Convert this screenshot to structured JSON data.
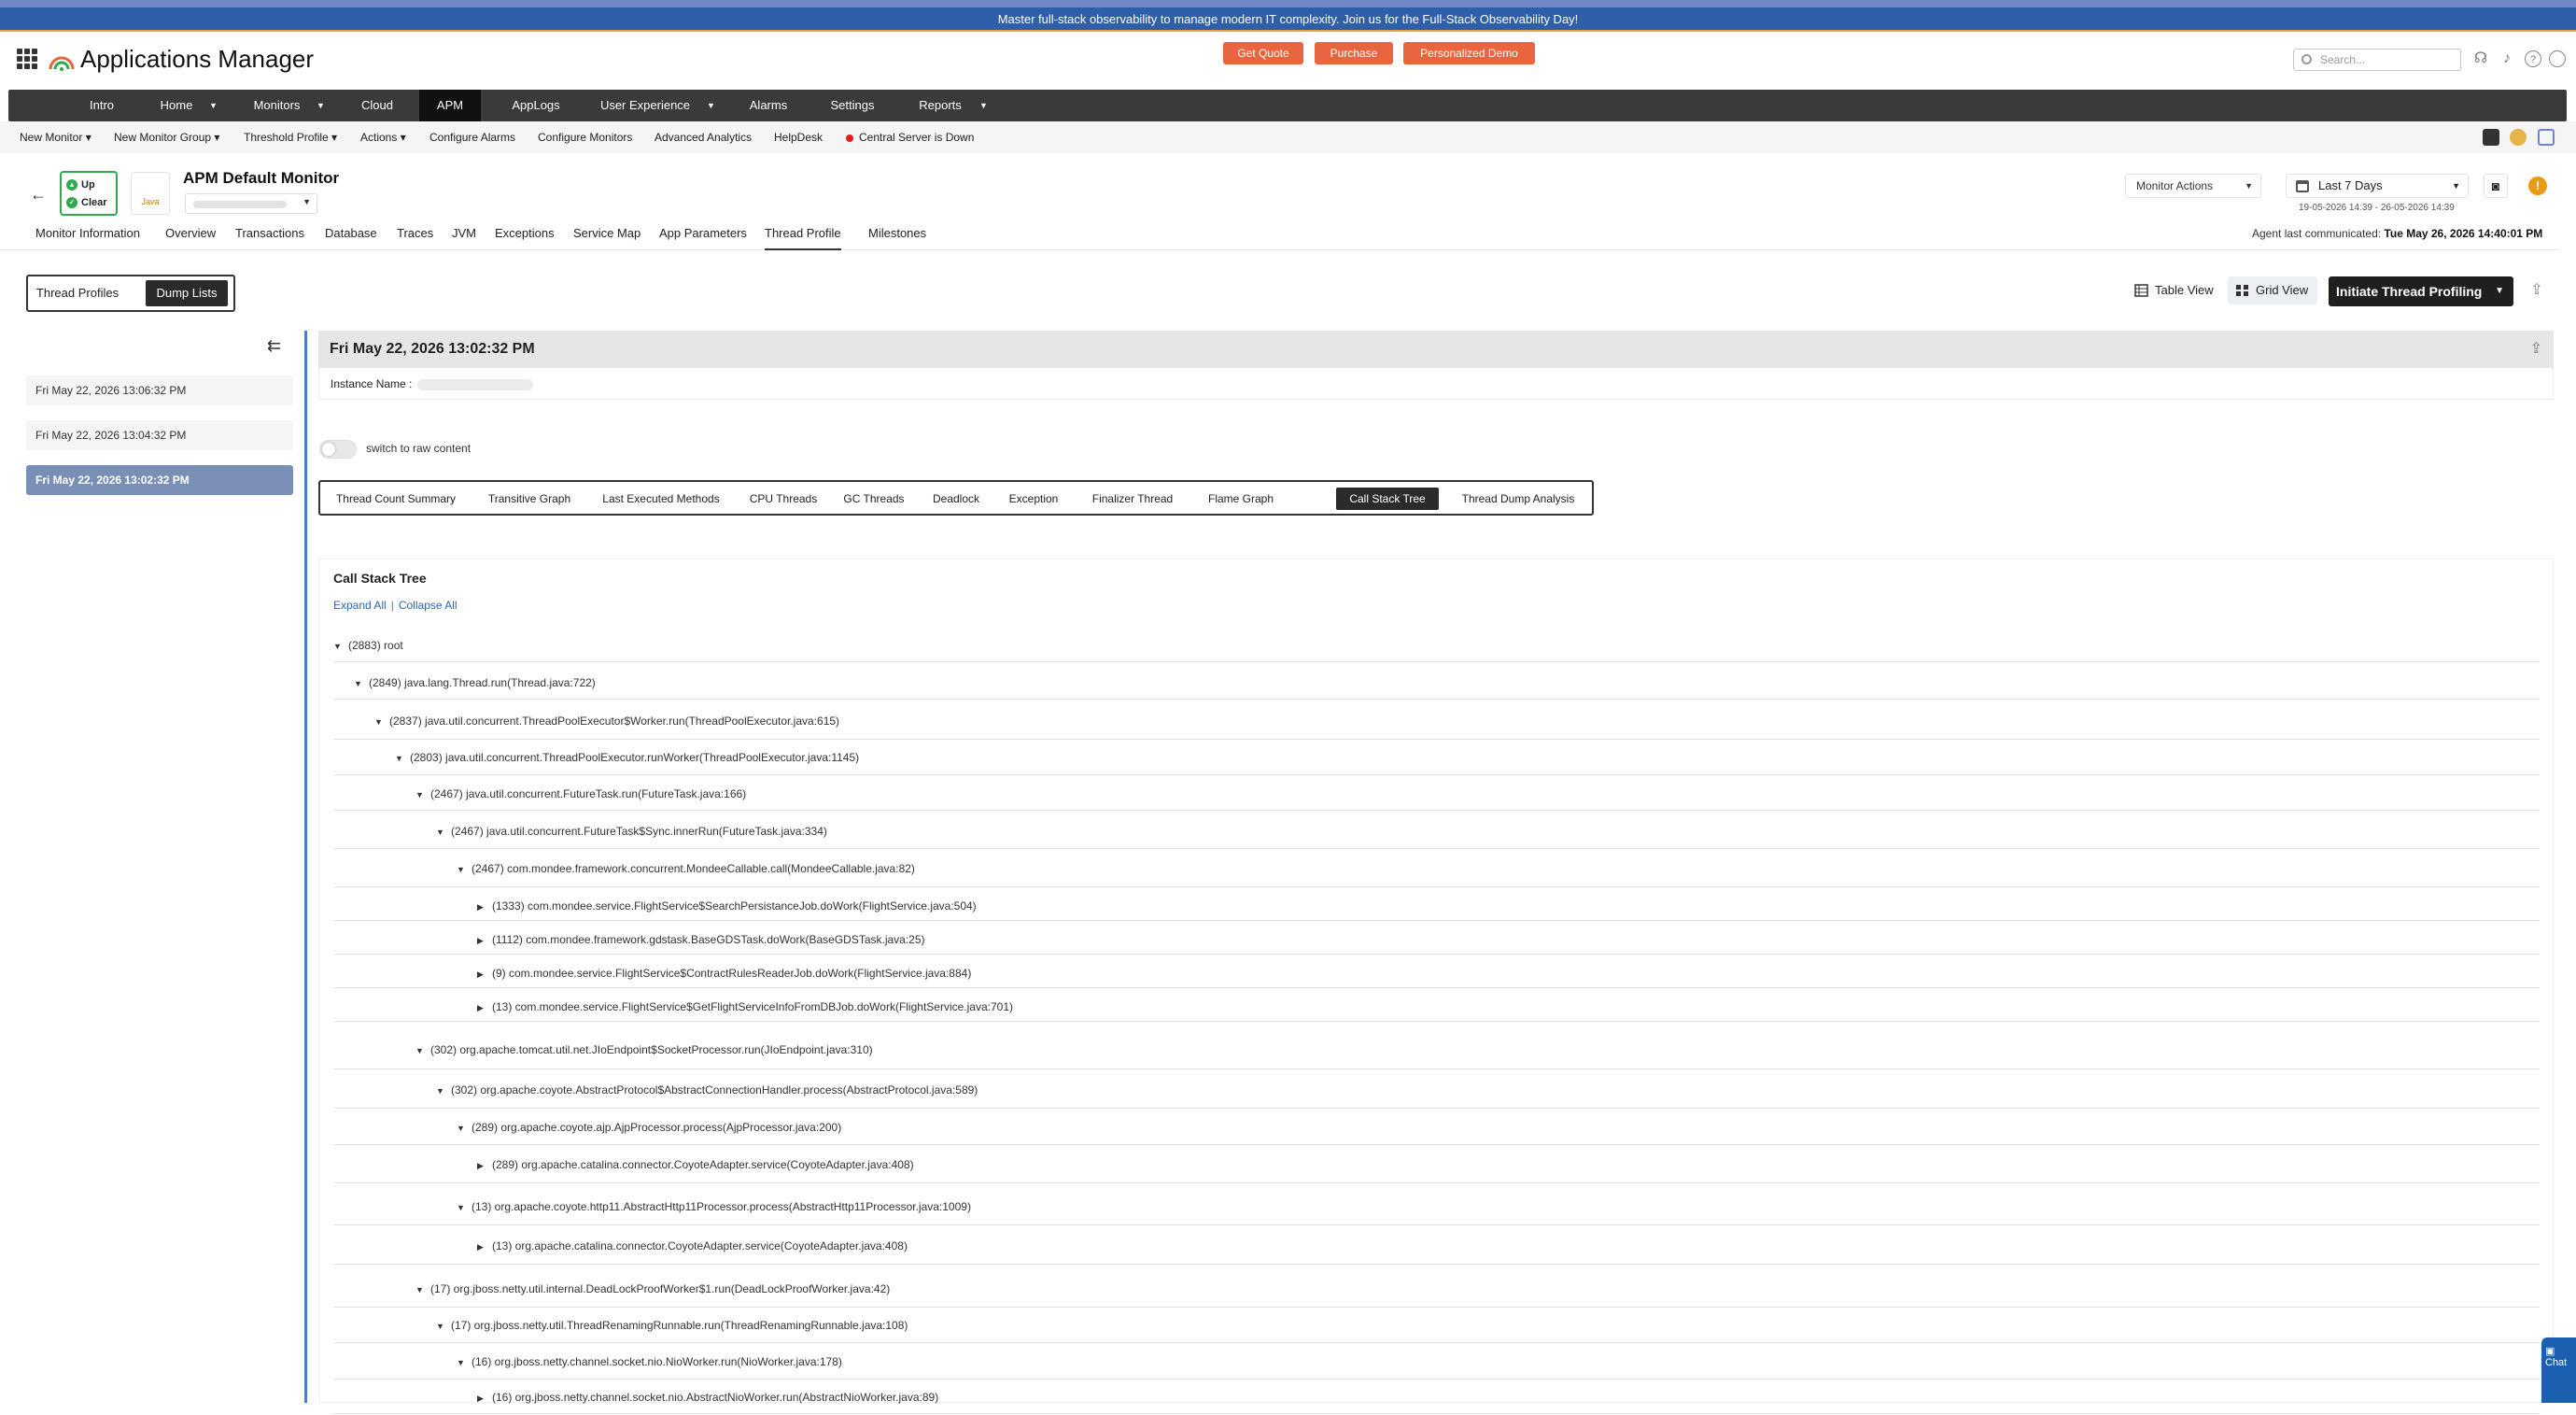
{
  "banner": "Master full-stack observability to manage modern IT complexity. Join us for the Full-Stack Observability Day!",
  "app": {
    "title": "Applications Manager",
    "accent": "#e9653f",
    "brand_green": "#2eaa4f"
  },
  "header": {
    "buttons": [
      "Get Quote",
      "Purchase",
      "Personalized Demo"
    ],
    "search_placeholder": "Search..."
  },
  "mainnav": [
    "Intro",
    "Home",
    "Monitors",
    "Cloud",
    "APM",
    "AppLogs",
    "User Experience",
    "Alarms",
    "Settings",
    "Reports"
  ],
  "mainnav_active": "APM",
  "subnav": [
    "New Monitor",
    "New Monitor Group",
    "Threshold Profile",
    "Actions",
    "Configure Alarms",
    "Configure Monitors",
    "Advanced Analytics",
    "HelpDesk",
    "Central Server is Down"
  ],
  "monitor": {
    "status_up": "Up",
    "status_clear": "Clear",
    "type_icon_label": "Java",
    "title": "APM Default Monitor",
    "actions_label": "Monitor Actions",
    "range_label": "Last 7 Days",
    "range_dates": "19-05-2026 14:39 - 26-05-2026 14:39"
  },
  "tabs": [
    "Monitor Information",
    "Overview",
    "Transactions",
    "Database",
    "Traces",
    "JVM",
    "Exceptions",
    "Service Map",
    "App Parameters",
    "Thread Profile",
    "Milestones"
  ],
  "tab_active": "Thread Profile",
  "agent": {
    "label": "Agent last communicated:",
    "value": "Tue May 26, 2026 14:40:01 PM"
  },
  "toggle": {
    "left": "Thread Profiles",
    "right": "Dump Lists"
  },
  "views": {
    "table": "Table View",
    "grid": "Grid View",
    "initiate": "Initiate Thread Profiling"
  },
  "dumps": [
    "Fri May 22, 2026 13:06:32 PM",
    "Fri May 22, 2026 13:04:32 PM",
    "Fri May 22, 2026 13:02:32 PM"
  ],
  "dump_active": "Fri May 22, 2026 13:02:32 PM",
  "panel": {
    "title": "Fri May 22, 2026 13:02:32 PM",
    "instance_label": "Instance Name :",
    "switch_label": "switch to raw content"
  },
  "subtabs": [
    "Thread Count Summary",
    "Transitive Graph",
    "Last Executed Methods",
    "CPU Threads",
    "GC Threads",
    "Deadlock",
    "Exception",
    "Finalizer Thread",
    "Flame Graph",
    "Call Stack Tree",
    "Thread Dump Analysis"
  ],
  "subtab_active": "Call Stack Tree",
  "tree": {
    "title": "Call Stack Tree",
    "expand_all": "Expand All",
    "collapse_all": "Collapse All",
    "nodes": [
      {
        "text": "(2883) root",
        "depth": 0,
        "open": true
      },
      {
        "text": "(2849) java.lang.Thread.run(Thread.java:722)",
        "depth": 1,
        "open": true
      },
      {
        "text": "(2837) java.util.concurrent.ThreadPoolExecutor$Worker.run(ThreadPoolExecutor.java:615)",
        "depth": 2,
        "open": true
      },
      {
        "text": "(2803) java.util.concurrent.ThreadPoolExecutor.runWorker(ThreadPoolExecutor.java:1145)",
        "depth": 3,
        "open": true
      },
      {
        "text": "(2467) java.util.concurrent.FutureTask.run(FutureTask.java:166)",
        "depth": 4,
        "open": true
      },
      {
        "text": "(2467) java.util.concurrent.FutureTask$Sync.innerRun(FutureTask.java:334)",
        "depth": 5,
        "open": true
      },
      {
        "text": "(2467) com.mondee.framework.concurrent.MondeeCallable.call(MondeeCallable.java:82)",
        "depth": 6,
        "open": true
      },
      {
        "text": "(1333) com.mondee.service.FlightService$SearchPersistanceJob.doWork(FlightService.java:504)",
        "depth": 7,
        "open": false
      },
      {
        "text": "(1112) com.mondee.framework.gdstask.BaseGDSTask.doWork(BaseGDSTask.java:25)",
        "depth": 7,
        "open": false
      },
      {
        "text": "(9) com.mondee.service.FlightService$ContractRulesReaderJob.doWork(FlightService.java:884)",
        "depth": 7,
        "open": false
      },
      {
        "text": "(13) com.mondee.service.FlightService$GetFlightServiceInfoFromDBJob.doWork(FlightService.java:701)",
        "depth": 7,
        "open": false
      },
      {
        "text": "(302) org.apache.tomcat.util.net.JIoEndpoint$SocketProcessor.run(JIoEndpoint.java:310)",
        "depth": 4,
        "open": true
      },
      {
        "text": "(302) org.apache.coyote.AbstractProtocol$AbstractConnectionHandler.process(AbstractProtocol.java:589)",
        "depth": 5,
        "open": true
      },
      {
        "text": "(289) org.apache.coyote.ajp.AjpProcessor.process(AjpProcessor.java:200)",
        "depth": 6,
        "open": true
      },
      {
        "text": "(289) org.apache.catalina.connector.CoyoteAdapter.service(CoyoteAdapter.java:408)",
        "depth": 7,
        "open": false
      },
      {
        "text": "(13) org.apache.coyote.http11.AbstractHttp11Processor.process(AbstractHttp11Processor.java:1009)",
        "depth": 6,
        "open": true
      },
      {
        "text": "(13) org.apache.catalina.connector.CoyoteAdapter.service(CoyoteAdapter.java:408)",
        "depth": 7,
        "open": false
      },
      {
        "text": "(17) org.jboss.netty.util.internal.DeadLockProofWorker$1.run(DeadLockProofWorker.java:42)",
        "depth": 4,
        "open": true
      },
      {
        "text": "(17) org.jboss.netty.util.ThreadRenamingRunnable.run(ThreadRenamingRunnable.java:108)",
        "depth": 5,
        "open": true
      },
      {
        "text": "(16) org.jboss.netty.channel.socket.nio.NioWorker.run(NioWorker.java:178)",
        "depth": 6,
        "open": true
      },
      {
        "text": "(16) org.jboss.netty.channel.socket.nio.AbstractNioWorker.run(AbstractNioWorker.java:89)",
        "depth": 7,
        "open": false
      }
    ]
  },
  "chat_label": "Chat"
}
